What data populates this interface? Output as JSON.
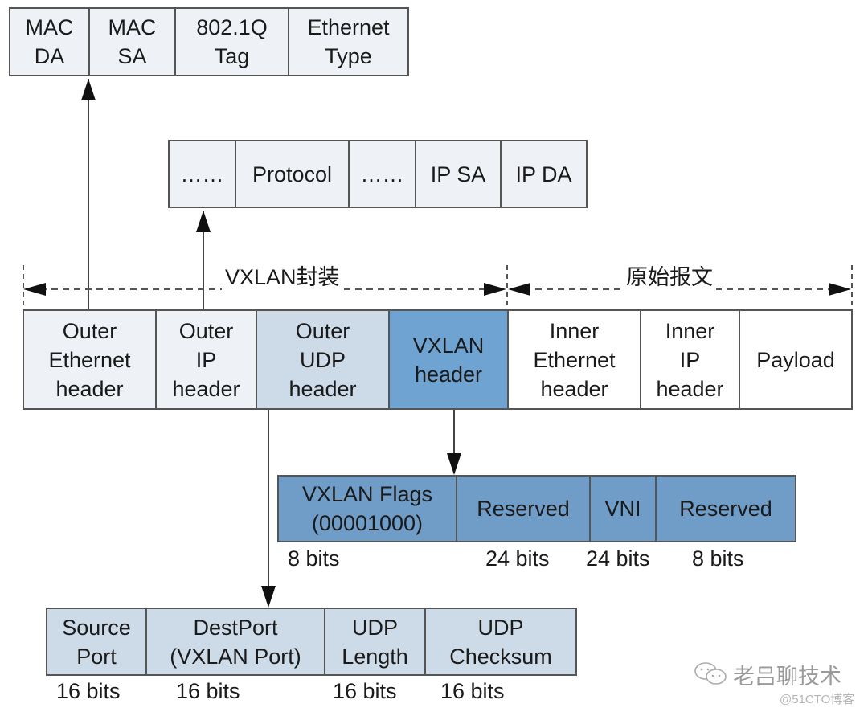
{
  "ethernet_header_fields": [
    "MAC\nDA",
    "MAC\nSA",
    "802.1Q\nTag",
    "Ethernet\nType"
  ],
  "ip_header_fields": [
    "……",
    "Protocol",
    "……",
    "IP SA",
    "IP DA"
  ],
  "spans": {
    "vxlan_encap": "VXLAN封装",
    "original_packet": "原始报文"
  },
  "packet_fields": [
    "Outer\nEthernet\nheader",
    "Outer\nIP\nheader",
    "Outer\nUDP\nheader",
    "VXLAN\nheader",
    "Inner\nEthernet\nheader",
    "Inner\nIP\nheader",
    "Payload"
  ],
  "vxlan_header_fields": [
    "VXLAN Flags\n(00001000)",
    "Reserved",
    "VNI",
    "Reserved"
  ],
  "vxlan_header_bits": [
    "8 bits",
    "24 bits",
    "24 bits",
    "8 bits"
  ],
  "udp_header_fields": [
    "Source\nPort",
    "DestPort\n(VXLAN Port)",
    "UDP\nLength",
    "UDP\nChecksum"
  ],
  "udp_header_bits": [
    "16 bits",
    "16 bits",
    "16 bits",
    "16 bits"
  ],
  "colors": {
    "light": "#eef2f6",
    "udp": "#cddbe8",
    "vxlan": "#6fa3d2",
    "vxlan_fields": "#6f9dc8",
    "border": "#555555"
  },
  "watermark": {
    "wechat_icon": "wechat-icon",
    "name": "老吕聊技术",
    "site": "@51CTO博客"
  }
}
